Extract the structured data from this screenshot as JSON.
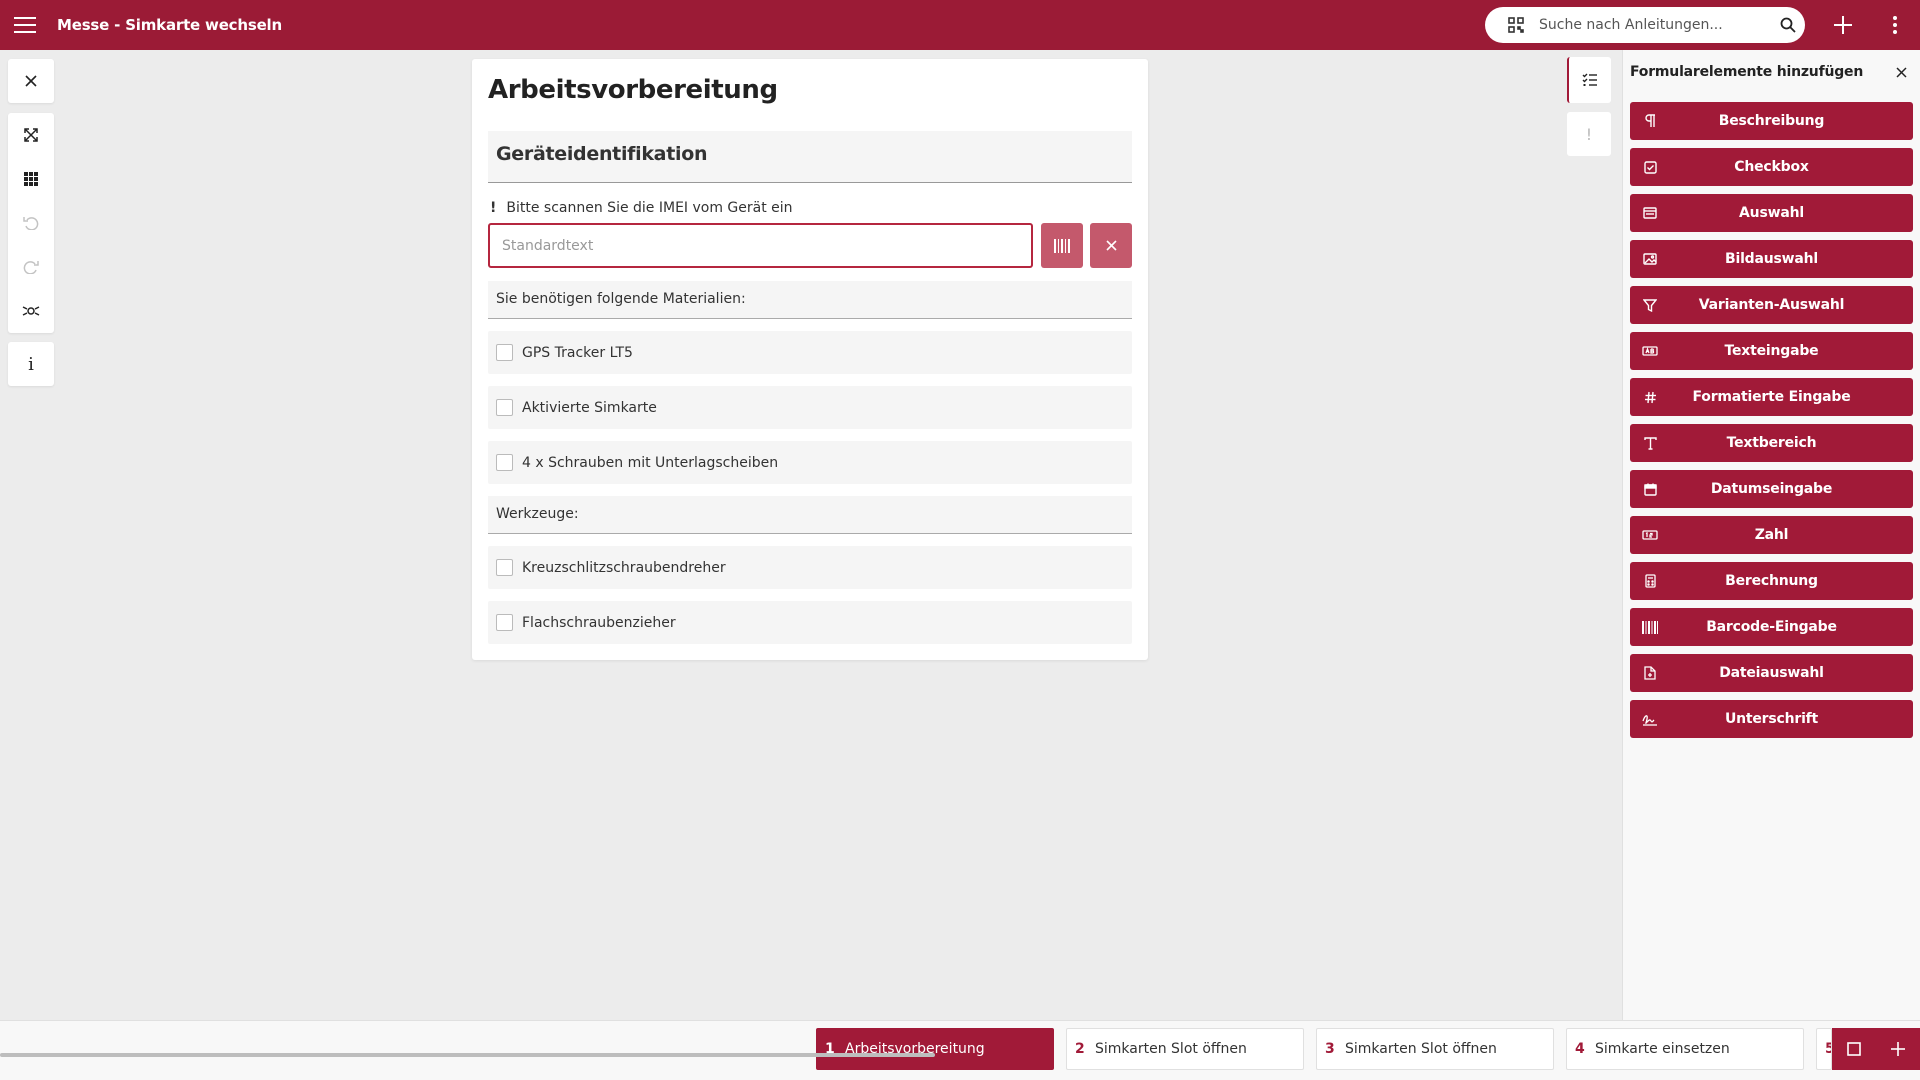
{
  "header": {
    "title": "Messe - Simkarte wechseln",
    "search_placeholder": "Suche nach Anleitungen..."
  },
  "card": {
    "title": "Arbeitsvorbereitung",
    "section_title": "Geräteidentifikation",
    "hint": "Bitte scannen Sie die IMEI vom Gerät ein",
    "hint_mark": "!",
    "input_placeholder": "Standardtext",
    "materials_label": "Sie benötigen folgende Materialien:",
    "materials": [
      "GPS Tracker LT5",
      "Aktivierte Simkarte",
      "4 x Schrauben mit Unterlagscheiben"
    ],
    "tools_label": "Werkzeuge:",
    "tools": [
      "Kreuzschlitzschraubendreher",
      "Flachschraubenzieher"
    ]
  },
  "right_panel": {
    "title": "Formularelemente hinzufügen",
    "buttons": [
      "Beschreibung",
      "Checkbox",
      "Auswahl",
      "Bildauswahl",
      "Varianten-Auswahl",
      "Texteingabe",
      "Formatierte Eingabe",
      "Textbereich",
      "Datumseingabe",
      "Zahl",
      "Berechnung",
      "Barcode-Eingabe",
      "Dateiauswahl",
      "Unterschrift"
    ]
  },
  "steps": [
    {
      "num": "1",
      "name": "Arbeitsvorbereitung"
    },
    {
      "num": "2",
      "name": "Simkarten Slot öffnen"
    },
    {
      "num": "3",
      "name": "Simkarten Slot öffnen"
    },
    {
      "num": "4",
      "name": "Simkarte einsetzen"
    },
    {
      "num": "5",
      "name": ""
    }
  ],
  "left_toolbar": {
    "info_label": "i"
  },
  "rail": {
    "alert_mark": "!"
  },
  "colors": {
    "brand": "#9b1b36",
    "button": "#a11a38",
    "secondary_button": "#c4596c"
  }
}
